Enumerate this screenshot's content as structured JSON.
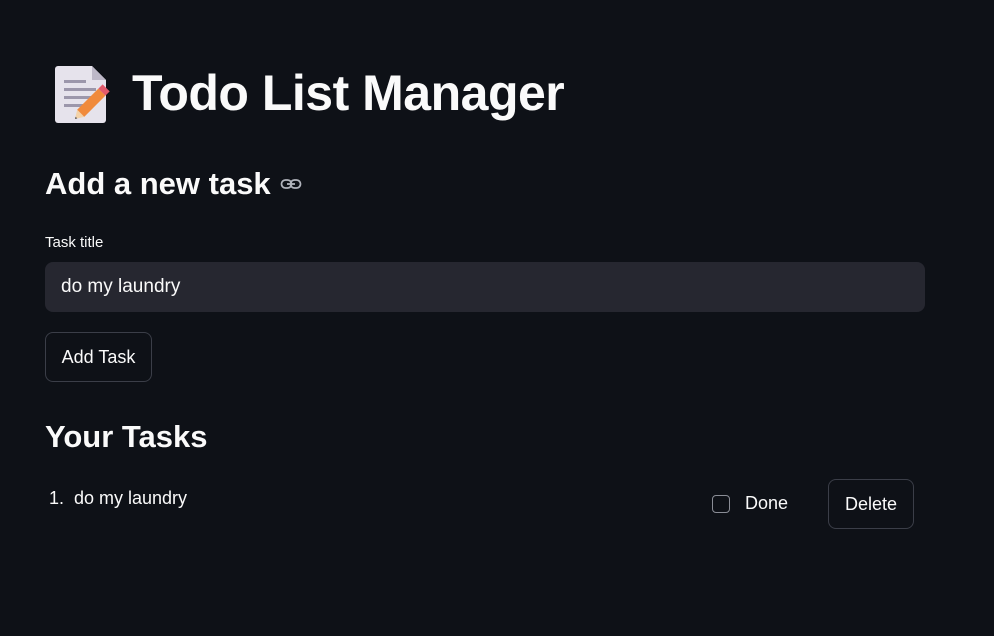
{
  "header": {
    "title": "Todo List Manager",
    "icon": "memo-icon"
  },
  "add_section": {
    "heading": "Add a new task",
    "anchor_icon": "link-icon",
    "field_label": "Task title",
    "input_value": "do my laundry",
    "add_button_label": "Add Task"
  },
  "tasks_section": {
    "heading": "Your Tasks",
    "items": [
      {
        "index": "1.",
        "title": "do my laundry",
        "done_label": "Done",
        "done": false,
        "delete_label": "Delete"
      }
    ]
  },
  "colors": {
    "background": "#0e1117",
    "input_background": "#262730",
    "text": "#fafafa",
    "border": "#3b3e48"
  }
}
